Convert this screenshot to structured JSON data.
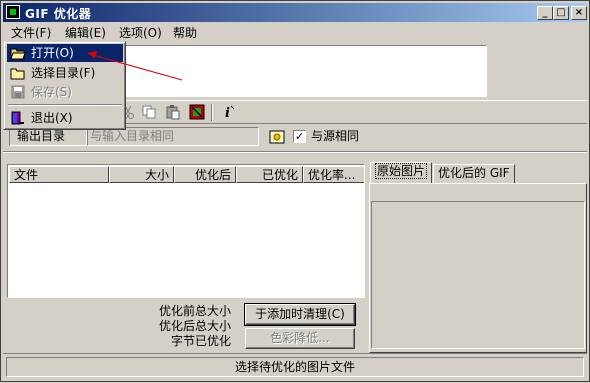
{
  "window": {
    "title": "GIF 优化器",
    "controls": {
      "minimize": "_",
      "maximize": "□",
      "close": "×"
    }
  },
  "menubar": {
    "items": [
      {
        "label": "文件(F)"
      },
      {
        "label": "编辑(E)"
      },
      {
        "label": "选项(O)"
      },
      {
        "label": "帮助"
      }
    ]
  },
  "file_menu": {
    "items": [
      {
        "label": "打开(O)",
        "icon": "open-folder-icon",
        "state": "selected"
      },
      {
        "label": "选择目录(F)",
        "icon": "folder-icon",
        "state": "normal"
      },
      {
        "label": "保存(S)",
        "icon": "save-icon",
        "state": "disabled"
      },
      {
        "label": "退出(X)",
        "icon": "exit-door-icon",
        "state": "normal"
      }
    ]
  },
  "output": {
    "label": "输出目录",
    "placeholder": "与输入目录相同",
    "same_as_source_label": "与源相同",
    "same_as_source_checked": true,
    "check_mark": "✓"
  },
  "file_list": {
    "columns": [
      "文件",
      "大小",
      "优化后",
      "已优化",
      "优化率..."
    ]
  },
  "preview_tabs": {
    "tabs": [
      "原始图片",
      "优化后的 GIF"
    ],
    "active": 0
  },
  "stats": {
    "total_before_label": "优化前总大小",
    "total_after_label": "优化后总大小",
    "bytes_saved_label": "字节已优化"
  },
  "buttons": {
    "clear_on_add": "于添加时清理(C)",
    "reduce_colors": "色彩降低..."
  },
  "status_bar": {
    "text": "选择待优化的图片文件"
  },
  "colors": {
    "title_start": "#0a246a",
    "title_end": "#a6caf0",
    "face": "#d4d0c8",
    "selection": "#0a246a",
    "annotation_arrow": "#e00000"
  }
}
